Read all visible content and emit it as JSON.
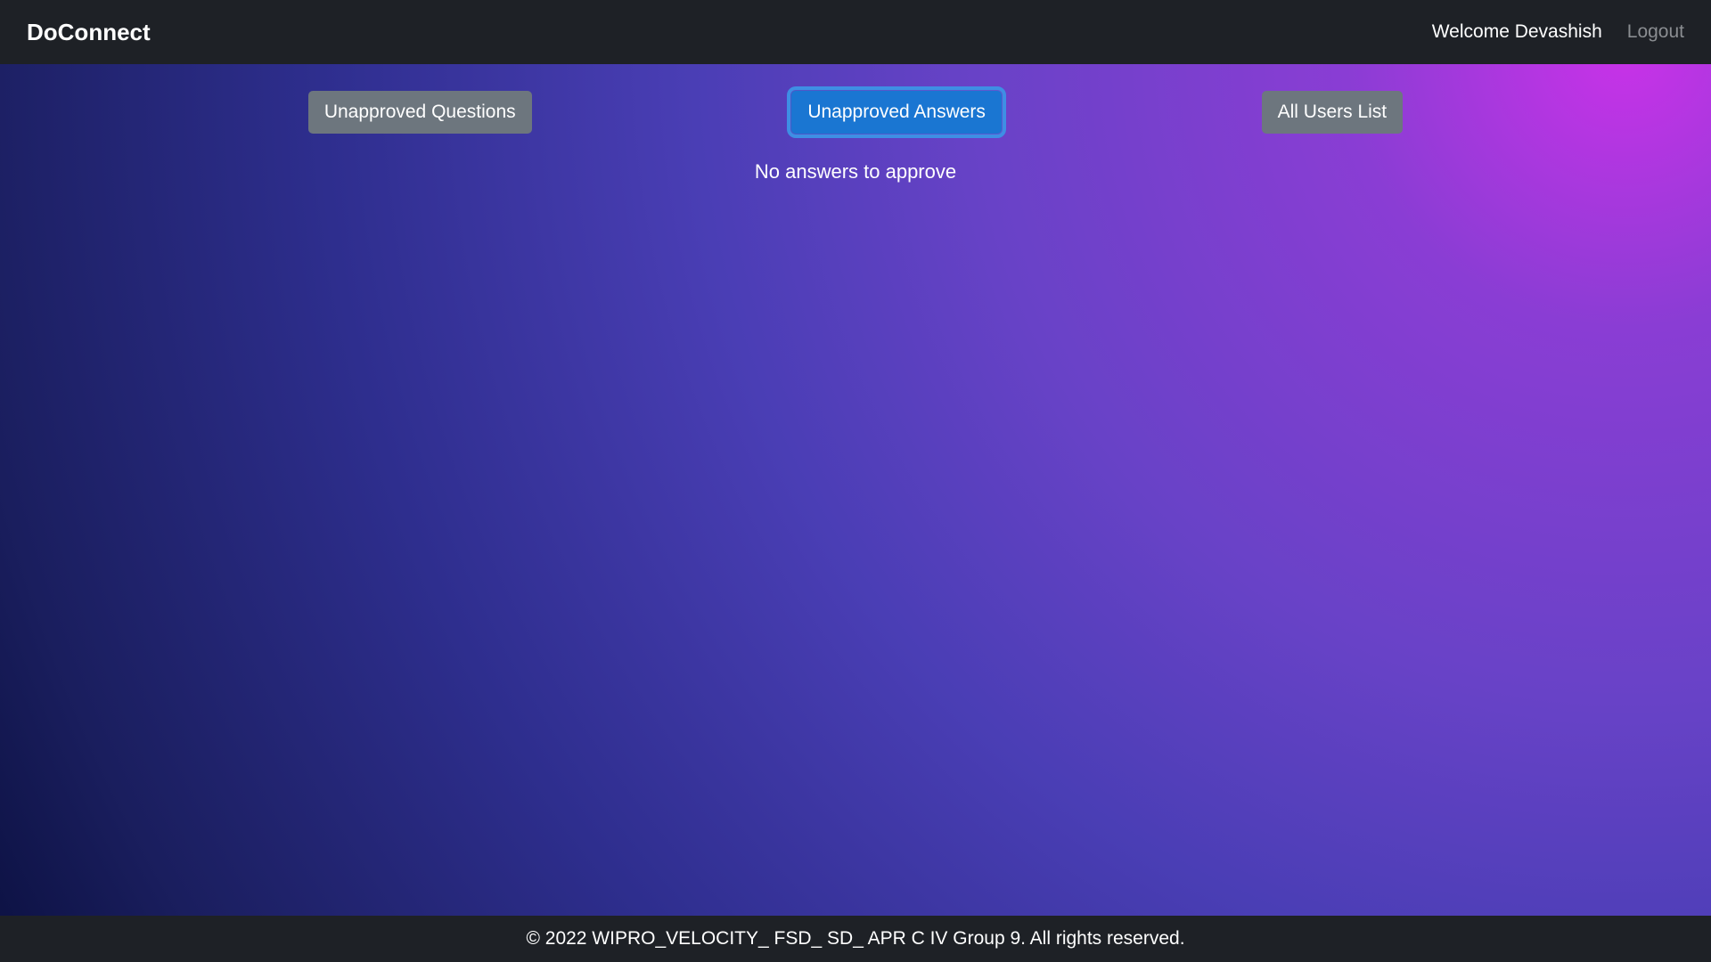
{
  "navbar": {
    "brand": "DoConnect",
    "welcome": "Welcome Devashish",
    "logout": "Logout"
  },
  "buttons": {
    "unapprovedQuestions": "Unapproved Questions",
    "unapprovedAnswers": "Unapproved Answers",
    "allUsersList": "All Users List"
  },
  "main": {
    "statusMessage": "No answers to approve"
  },
  "footer": {
    "copyright": "© 2022 WIPRO_VELOCITY_ FSD_ SD_ APR C IV Group 9. All rights reserved."
  }
}
